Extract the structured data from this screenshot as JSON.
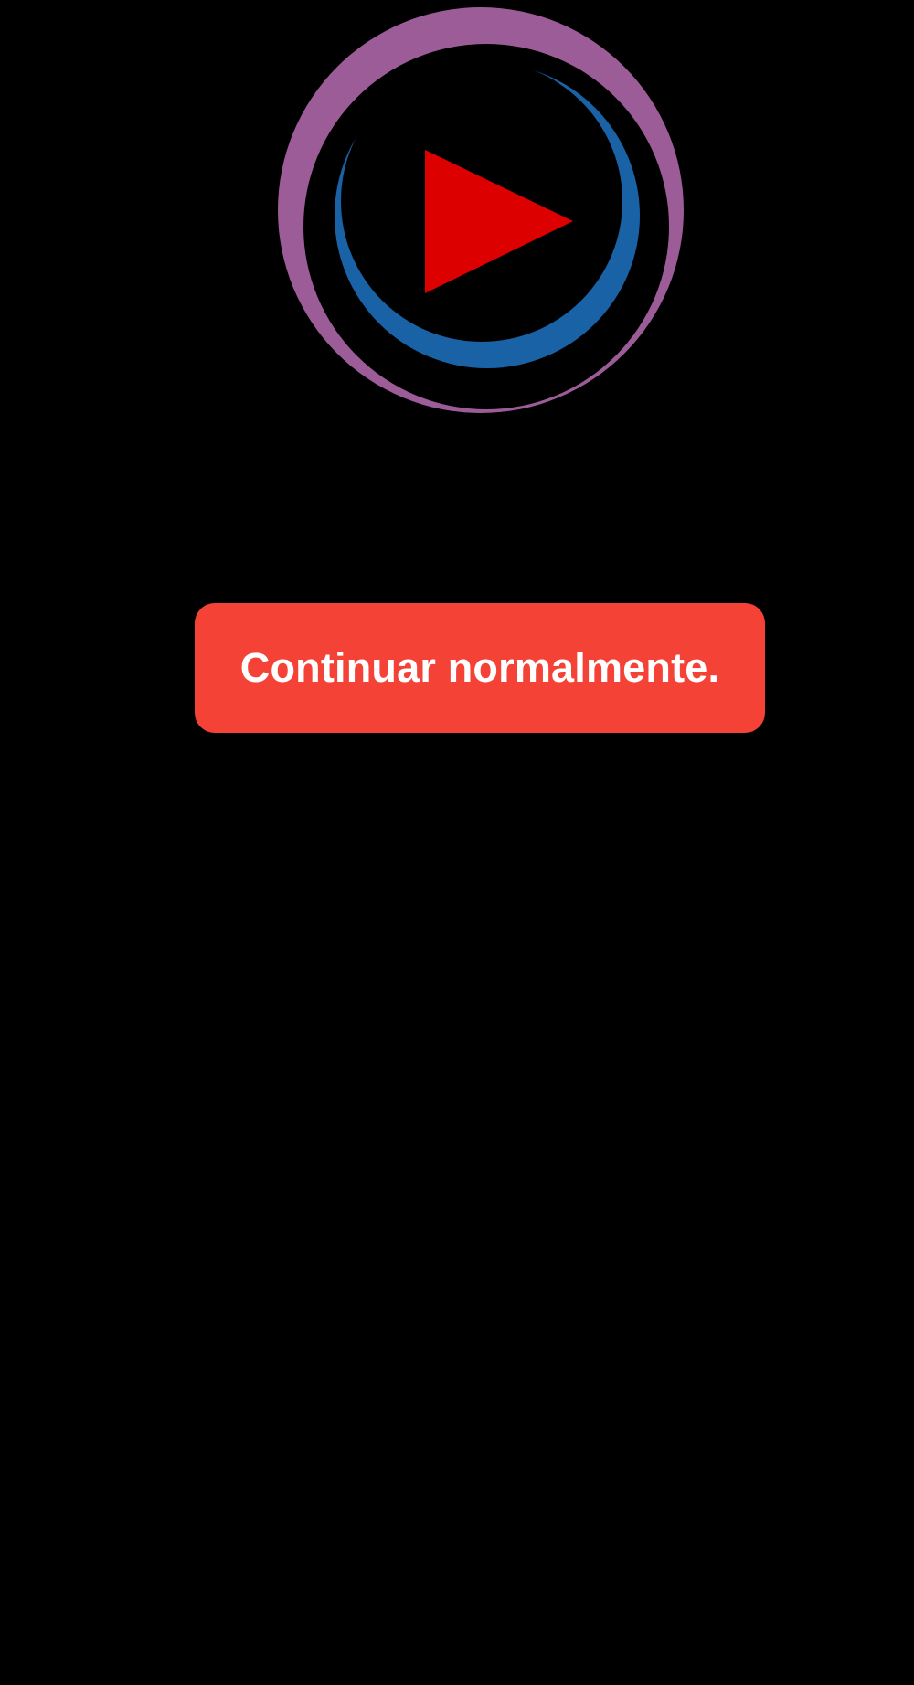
{
  "splash": {
    "logo": {
      "icon": "play-button-logo-icon",
      "outer_ring_color": "#9c5c98",
      "inner_ring_color": "#1a62a6",
      "play_triangle_color": "#dd0000"
    },
    "continue_button": {
      "label": "Continuar normalmente.",
      "background_color": "#f44336",
      "text_color": "#ffffff"
    },
    "background_color": "#000000"
  }
}
